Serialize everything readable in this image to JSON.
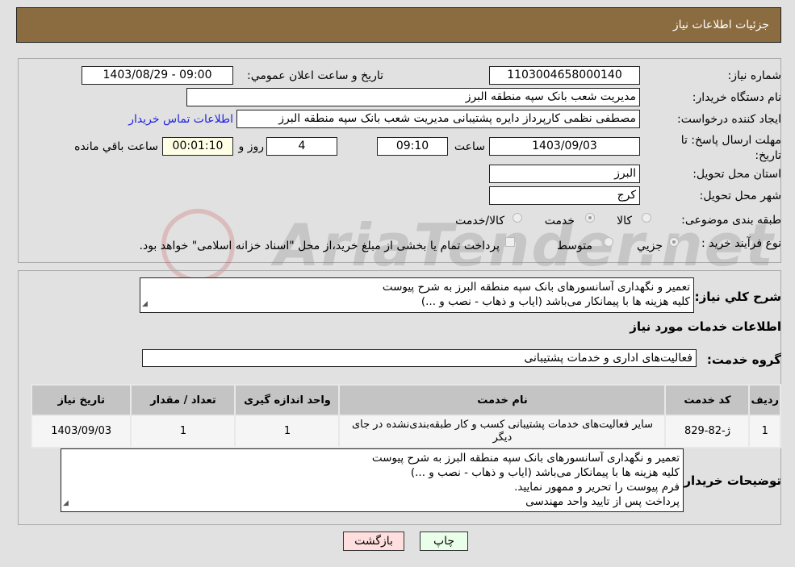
{
  "header": {
    "title": "جزئیات اطلاعات نیاز"
  },
  "form": {
    "need_number_label": "شماره نیاز:",
    "need_number": "1103004658000140",
    "announce_label": "تاریخ و ساعت اعلان عمومي:",
    "announce_value": "1403/08/29 - 09:00",
    "buyer_org_label": "نام دستگاه خریدار:",
    "buyer_org": "مدیریت شعب بانک سپه منطقه البرز",
    "creator_label": "ایجاد کننده درخواست:",
    "creator": "مصطفی نظمی کارپرداز دایره پشتیبانی مدیریت شعب بانک سپه منطقه البرز",
    "contact_link": "اطلاعات تماس خریدار",
    "deadline_label": "مهلت ارسال پاسخ: تا تاریخ:",
    "deadline_date": "1403/09/03",
    "time_label": "ساعت",
    "deadline_time": "09:10",
    "days": "4",
    "days_label": "روز و",
    "remaining": "00:01:10",
    "remaining_label": "ساعت باقي مانده",
    "province_label": "استان محل تحویل:",
    "province": "البرز",
    "city_label": "شهر محل تحویل:",
    "city": "کرج",
    "category_label": "طبقه بندی موضوعی:",
    "category_options": [
      "کالا",
      "خدمت",
      "کالا/خدمت"
    ],
    "category_selected": "خدمت",
    "process_label": "نوع فرآیند خرید :",
    "process_options": [
      "جزيي",
      "متوسط"
    ],
    "process_selected": "جزيي",
    "payment_note": "پرداخت تمام یا بخشی از مبلغ خرید،از محل \"اسناد خزانه اسلامی\" خواهد بود."
  },
  "watermark": "AriaTender.net",
  "details": {
    "summary_label": "شرح کلي نیاز:",
    "summary_lines": [
      "تعمیر و نگهداری آسانسورهای بانک سپه منطقه البرز به شرح پیوست",
      "کلیه هزینه ها با پیمانکار می‌باشد (ایاب و ذهاب - نصب و ...)"
    ],
    "services_title": "اطلاعات خدمات مورد نیاز",
    "group_label": "گروه خدمت:",
    "group_value": "فعالیت‌های اداری و خدمات پشتیبانی",
    "table": {
      "headers": [
        "ردیف",
        "کد خدمت",
        "نام خدمت",
        "واحد اندازه گیری",
        "تعداد / مقدار",
        "تاریخ نیاز"
      ],
      "rows": [
        [
          "1",
          "ژ-82-829",
          "سایر فعالیت‌های خدمات پشتیبانی کسب و کار طبقه‌بندی‌نشده در جای دیگر",
          "1",
          "1",
          "1403/09/03"
        ]
      ]
    },
    "buyer_notes_label": "توضیحات خریدار:",
    "buyer_notes_lines": [
      "تعمیر و نگهداری آسانسورهای بانک سپه منطقه البرز به شرح پیوست",
      "کلیه هزینه ها با پیمانکار می‌باشد (ایاب و ذهاب - نصب و ...)",
      "فرم پیوست را تحریر و ممهور نمایید.",
      "پرداخت پس از تایید واحد مهندسی"
    ]
  },
  "buttons": {
    "print": "چاپ",
    "back": "بازگشت"
  },
  "colors": {
    "header": "#8b6b40",
    "link": "#2222dd",
    "print_bg": "#eaffea",
    "back_bg": "#ffdede"
  }
}
